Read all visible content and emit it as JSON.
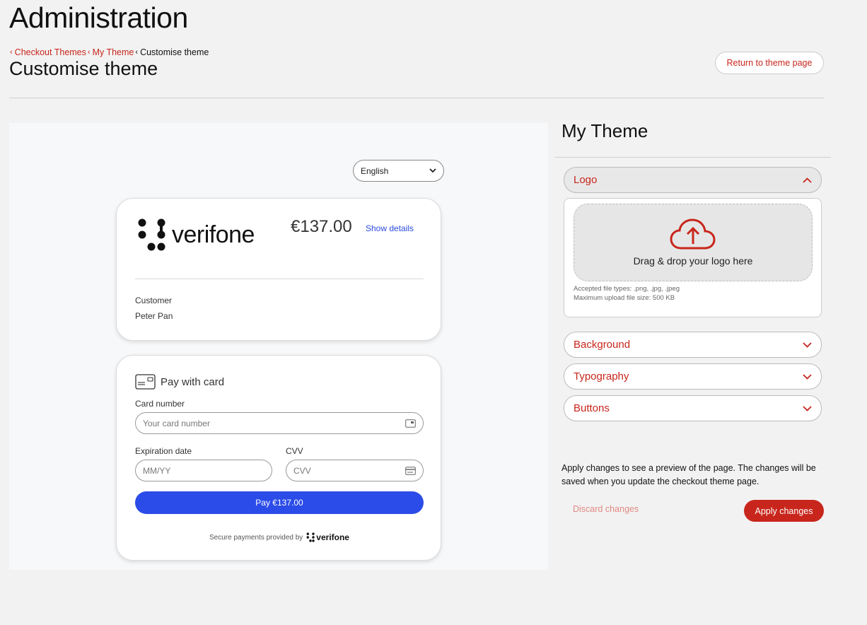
{
  "app": {
    "title": "Administration"
  },
  "breadcrumb": {
    "items": [
      {
        "label": "Checkout Themes"
      },
      {
        "label": "My Theme"
      },
      {
        "label": "Customise theme"
      }
    ]
  },
  "page": {
    "title": "Customise theme",
    "return_label": "Return to theme page"
  },
  "preview": {
    "language": "English",
    "brand": "verifone",
    "amount": "€137.00",
    "show_details": "Show details",
    "customer_label": "Customer",
    "customer_name": "Peter Pan",
    "pay_title": "Pay with card",
    "card_number_label": "Card number",
    "card_number_placeholder": "Your card number",
    "expiry_label": "Expiration date",
    "expiry_placeholder": "MM/YY",
    "cvv_label": "CVV",
    "cvv_placeholder": "CVV",
    "pay_button": "Pay €137.00",
    "secure_text": "Secure payments provided by",
    "secure_brand": "verifone",
    "colors": {
      "pay_button": "#2b4ce8",
      "link": "#2b4cdf"
    }
  },
  "panel": {
    "title": "My Theme",
    "sections": [
      {
        "label": "Logo",
        "expanded": true
      },
      {
        "label": "Background",
        "expanded": false
      },
      {
        "label": "Typography",
        "expanded": false
      },
      {
        "label": "Buttons",
        "expanded": false
      }
    ],
    "logo": {
      "drop_text": "Drag & drop your logo here",
      "accepted": "Accepted file types: .png, .jpg, .jpeg",
      "max_size": "Maximum upload file size: 500 KB",
      "icon": "cloud-upload-icon"
    },
    "apply_note": "Apply changes to see a preview of the page. The changes will be saved when you update the checkout theme page.",
    "discard_label": "Discard changes",
    "apply_label": "Apply changes"
  },
  "colors": {
    "accent": "#c8261c",
    "background": "#f2f2f2"
  }
}
